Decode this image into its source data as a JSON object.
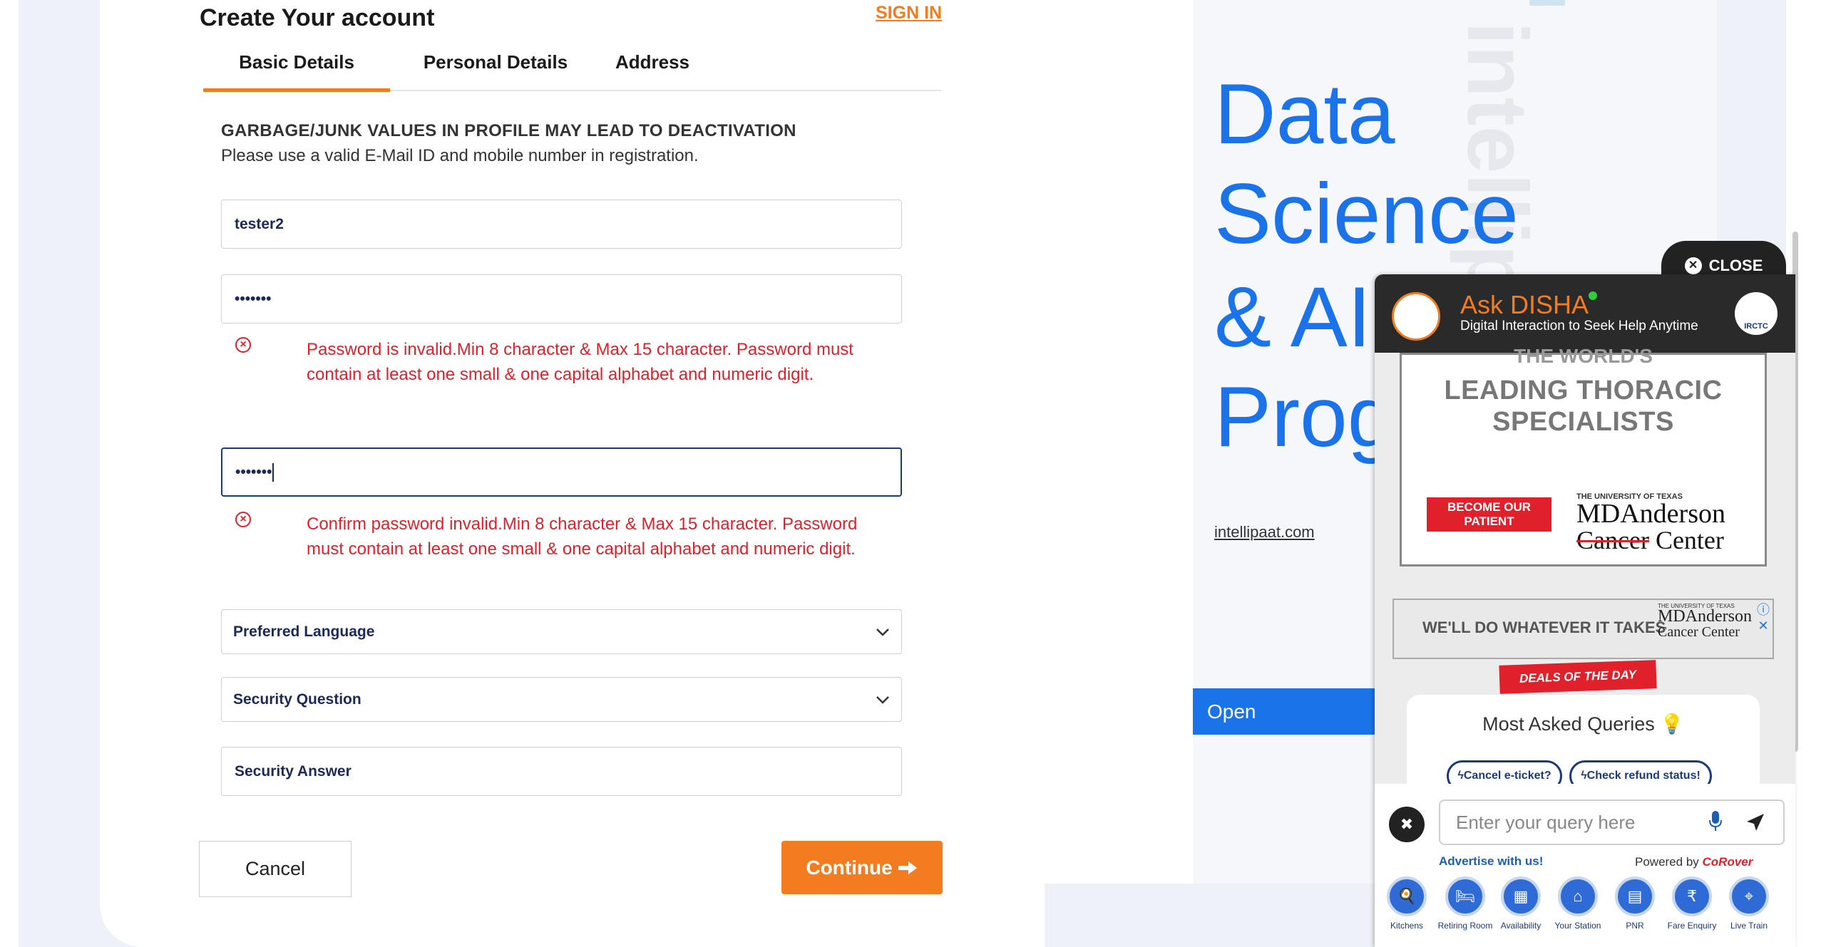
{
  "form": {
    "title": "Create Your account",
    "signin": "SIGN IN",
    "tabs": [
      "Basic Details",
      "Personal Details",
      "Address"
    ],
    "warning_title": "GARBAGE/JUNK VALUES IN PROFILE MAY LEAD TO DEACTIVATION",
    "warning_sub": "Please use a valid E-Mail ID and mobile number in registration.",
    "username_value": "tester2",
    "password_value": "•••••••",
    "password_error": "Password is invalid.Min 8 character & Max 15 character. Password must contain at least one small & one capital alphabet and numeric digit.",
    "confirm_value": "•••••••",
    "confirm_error": "Confirm password invalid.Min 8 character & Max 15 character. Password must contain at least one small & one capital alphabet and numeric digit.",
    "language_placeholder": "Preferred Language",
    "security_question_placeholder": "Security Question",
    "security_answer_placeholder": "Security Answer",
    "cancel_label": "Cancel",
    "continue_label": "Continue",
    "accent_color": "#f47c20",
    "error_color": "#e0202b"
  },
  "ad": {
    "line1": "Data",
    "line2": "Science",
    "line3": "& AI",
    "line4": "Prog",
    "watermark": "intellipaat",
    "link": "intellipaat.com",
    "open_label": "Open",
    "accent_color": "#1a73e8"
  },
  "disha": {
    "close_label": "CLOSE",
    "name": "Ask DISHA",
    "tagline": "Digital Interaction to Seek Help Anytime",
    "irctc": "IRCTC",
    "md_top": "THE WORLD'S",
    "md_lead1": "LEADING THORACIC",
    "md_lead2": "SPECIALISTS",
    "md_become": "BECOME OUR PATIENT",
    "md_uni": "THE UNIVERSITY OF TEXAS",
    "md_brand": "MDAnderson",
    "md_brand2_strike": "Cancer",
    "md_brand2_rest": " Center",
    "banner2_text": "WE'LL DO WHATEVER IT TAKES",
    "banner2_uni": "THE UNIVERSITY OF TEXAS",
    "banner2_brand": "MDAnderson",
    "banner2_brand2": "Cancer Center",
    "deals": "DEALS OF THE DAY",
    "faq_title": "Most Asked Queries",
    "chips": [
      "Cancel e-ticket?",
      "Check refund status!"
    ],
    "query_placeholder": "Enter your query here",
    "advertise": "Advertise with us!",
    "powered_by": "Powered by",
    "powered_brand": "CoRover",
    "shortcuts": [
      "Kitchens",
      "Retiring Room",
      "Availability",
      "Your Station",
      "PNR",
      "Fare Enquiry",
      "Live Train"
    ]
  }
}
